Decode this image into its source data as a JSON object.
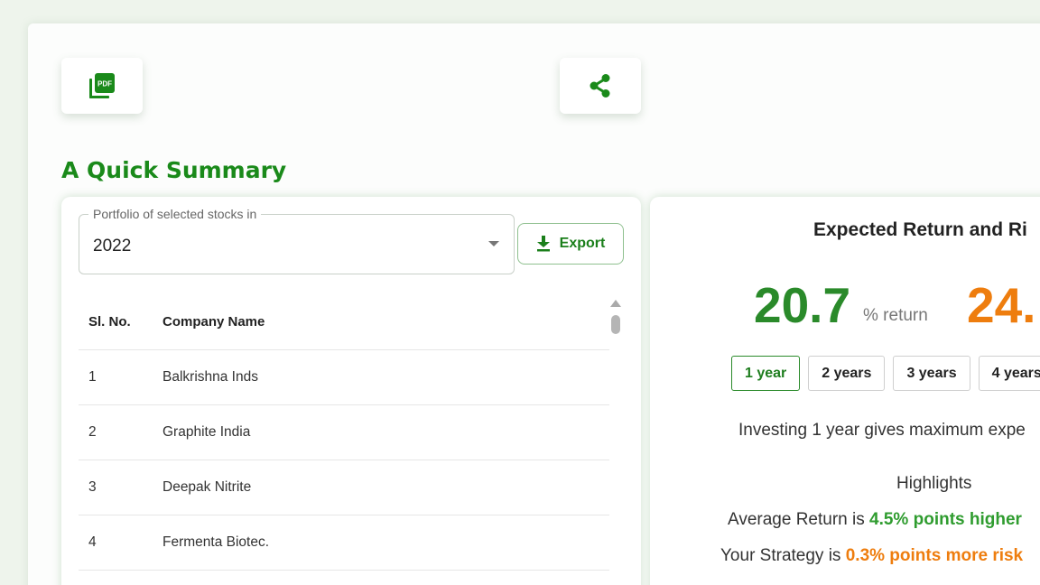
{
  "colors": {
    "brand_green": "#1a8a1a",
    "return_green": "#2a8a2a",
    "risk_orange": "#ee7d0e"
  },
  "toolbar": {
    "pdf_icon": "pdf-icon",
    "pdf_icon_text": "PDF",
    "share_icon": "share-icon"
  },
  "summary": {
    "title": "A Quick Summary"
  },
  "portfolio": {
    "select_label": "Portfolio of selected stocks in",
    "select_value": "2022",
    "export_label": "Export",
    "table": {
      "headers": [
        "Sl. No.",
        "Company Name"
      ],
      "rows": [
        {
          "sl": "1",
          "name": "Balkrishna Inds"
        },
        {
          "sl": "2",
          "name": "Graphite India"
        },
        {
          "sl": "3",
          "name": "Deepak Nitrite"
        },
        {
          "sl": "4",
          "name": "Fermenta Biotec."
        }
      ]
    }
  },
  "expected": {
    "title": "Expected Return and Ri",
    "return_value": "20.7",
    "return_unit": "% return",
    "risk_value": "24.",
    "tabs": [
      "1 year",
      "2 years",
      "3 years",
      "4 years"
    ],
    "active_tab": "1 year",
    "invest_text": "Investing 1 year gives maximum expe",
    "highlights_title": "Highlights",
    "hl1_prefix": "Average Return is ",
    "hl1_value": "4.5% points higher",
    "hl2_prefix": "Your Strategy is ",
    "hl2_value": "0.3% points more risk"
  }
}
